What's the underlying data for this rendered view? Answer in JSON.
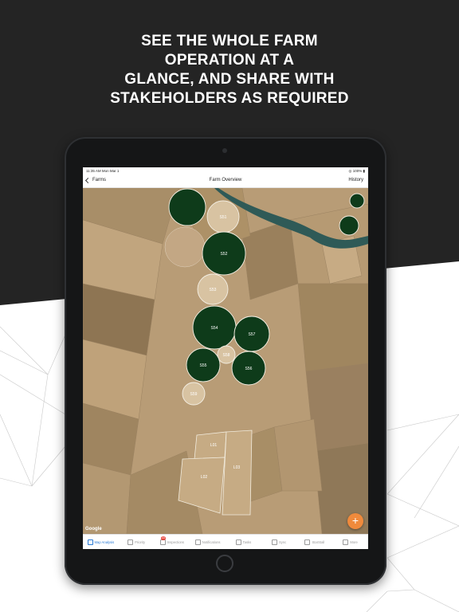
{
  "headline": [
    "SEE THE WHOLE FARM",
    "OPERATION AT A",
    "GLANCE, AND SHARE WITH",
    "STAKEHOLDERS AS REQUIRED"
  ],
  "status_bar": {
    "time_date": "11:35 AM   Mon Mar 1",
    "battery": "100%"
  },
  "nav": {
    "back_label": "Farms",
    "title": "Farm Overview",
    "right_label": "History"
  },
  "fields": {
    "s51": "S51",
    "s52": "S52",
    "s53": "S53",
    "s54": "S54",
    "s55": "S55",
    "s56": "S56",
    "s57": "S57",
    "s58": "S58",
    "s59": "S59",
    "l01": "L01",
    "l02": "L02",
    "l03": "L03"
  },
  "map_attribution": "Google",
  "fab_label": "+",
  "tabs": [
    {
      "label": "Map Analysis",
      "icon": "map-icon",
      "active": true
    },
    {
      "label": "Priority",
      "icon": "priority-icon"
    },
    {
      "label": "Inspections",
      "icon": "inspections-icon",
      "badge": "33"
    },
    {
      "label": "Notifications",
      "icon": "notifications-icon"
    },
    {
      "label": "Tasks",
      "icon": "tasks-icon"
    },
    {
      "label": "Sync",
      "icon": "sync-icon"
    },
    {
      "label": "StarStall",
      "icon": "starstall-icon"
    },
    {
      "label": "More",
      "icon": "more-icon"
    }
  ],
  "colors": {
    "dark_band": "#242424",
    "irrigated_field": "#0e3b1a",
    "accent": "#2a7bd6",
    "fab": "#f08a3c"
  }
}
